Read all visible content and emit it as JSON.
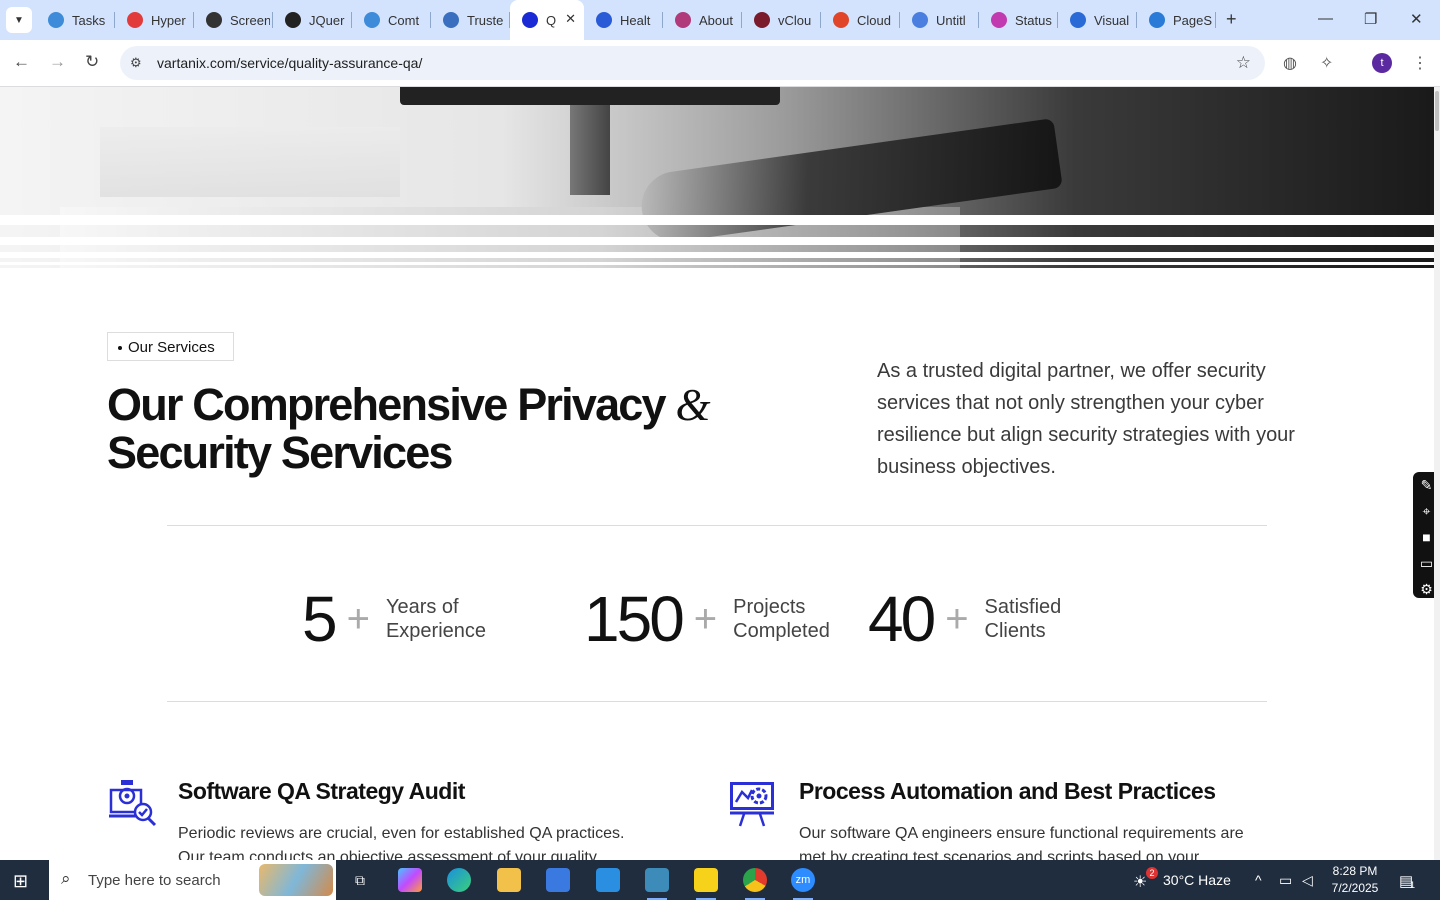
{
  "browser": {
    "tabs": [
      {
        "label": "Tasks",
        "color": "#3d8bd9"
      },
      {
        "label": "Hyper",
        "color": "#e23b3b"
      },
      {
        "label": "Screen",
        "color": "#333333"
      },
      {
        "label": "JQuer",
        "color": "#222222"
      },
      {
        "label": "Comt",
        "color": "#3d8bd9"
      },
      {
        "label": "Truste",
        "color": "#3a6fbf"
      },
      {
        "label": "Q",
        "color": "#1a2bd6",
        "active": true
      },
      {
        "label": "Healt",
        "color": "#2a5bd7"
      },
      {
        "label": "About",
        "color": "#b03a7a"
      },
      {
        "label": "vClou",
        "color": "#7a1a2a"
      },
      {
        "label": "Cloud",
        "color": "#e0452a"
      },
      {
        "label": "Untitl",
        "color": "#4a7fe0"
      },
      {
        "label": "Status",
        "color": "#c23ab0"
      },
      {
        "label": "Visual",
        "color": "#2a6ad7"
      },
      {
        "label": "PageS",
        "color": "#2a7ad7"
      }
    ],
    "url": "vartanix.com/service/quality-assurance-qa/",
    "profile_initial": "t"
  },
  "page": {
    "tag_label": "Our Services",
    "heading_part1": "Our Comprehensive Privacy ",
    "heading_amp": "&",
    "heading_part2": "Security Services",
    "intro": "As a trusted digital partner, we offer security services that not only strengthen your cyber resilience but align security strategies with your business objectives.",
    "stats": [
      {
        "number": "5",
        "plus": "+",
        "label": "Years of Experience"
      },
      {
        "number": "150",
        "plus": "+",
        "label": "Projects Completed"
      },
      {
        "number": "40",
        "plus": "+",
        "label": "Satisfied Clients"
      }
    ],
    "services": [
      {
        "title": "Software QA Strategy Audit",
        "desc": "Periodic reviews are crucial, even for established QA practices. Our team conducts an objective assessment of your quality"
      },
      {
        "title": "Process Automation and Best Practices",
        "desc": "Our software QA engineers ensure functional requirements are met by creating test scenarios and scripts based on your"
      }
    ],
    "accent_color": "#2b2fd6"
  },
  "taskbar": {
    "search_placeholder": "Type here to search",
    "weather": "30°C  Haze",
    "weather_badge": "2",
    "time": "8:28 PM",
    "date": "7/2/2025",
    "notif_count": "1"
  }
}
